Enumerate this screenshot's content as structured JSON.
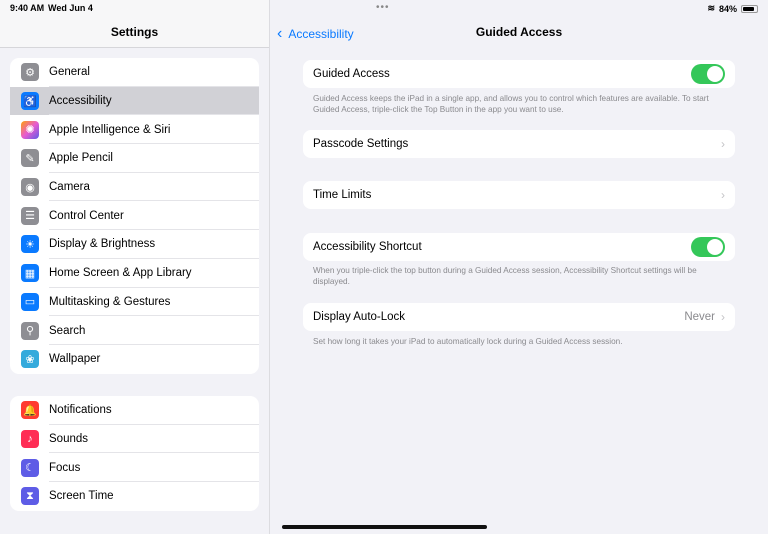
{
  "status": {
    "time": "9:40 AM",
    "date": "Wed Jun 4",
    "battery": "84%"
  },
  "sidebar": {
    "title": "Settings",
    "group1": [
      {
        "label": "General",
        "icon": "gear-icon",
        "color": "#8e8e93",
        "glyph": "⚙"
      },
      {
        "label": "Accessibility",
        "icon": "accessibility-icon",
        "color": "#0a7aff",
        "glyph": "♿"
      },
      {
        "label": "Apple Intelligence & Siri",
        "icon": "siri-icon",
        "color": "#e85bd0",
        "glyph": "✺"
      },
      {
        "label": "Apple Pencil",
        "icon": "pencil-icon",
        "color": "#8e8e93",
        "glyph": "✎"
      },
      {
        "label": "Camera",
        "icon": "camera-icon",
        "color": "#8e8e93",
        "glyph": "◉"
      },
      {
        "label": "Control Center",
        "icon": "toggles-icon",
        "color": "#8e8e93",
        "glyph": "☰"
      },
      {
        "label": "Display & Brightness",
        "icon": "sun-icon",
        "color": "#0a7aff",
        "glyph": "☀"
      },
      {
        "label": "Home Screen & App Library",
        "icon": "home-screen-icon",
        "color": "#0a7aff",
        "glyph": "▦"
      },
      {
        "label": "Multitasking & Gestures",
        "icon": "multitasking-icon",
        "color": "#0a7aff",
        "glyph": "▭"
      },
      {
        "label": "Search",
        "icon": "search-icon",
        "color": "#8e8e93",
        "glyph": "⚲"
      },
      {
        "label": "Wallpaper",
        "icon": "wallpaper-icon",
        "color": "#34aadc",
        "glyph": "❀"
      }
    ],
    "group2": [
      {
        "label": "Notifications",
        "icon": "bell-icon",
        "color": "#ff3b30",
        "glyph": "🔔"
      },
      {
        "label": "Sounds",
        "icon": "speaker-icon",
        "color": "#ff2d55",
        "glyph": "♪"
      },
      {
        "label": "Focus",
        "icon": "moon-icon",
        "color": "#5e5ce6",
        "glyph": "☾"
      },
      {
        "label": "Screen Time",
        "icon": "hourglass-icon",
        "color": "#5e5ce6",
        "glyph": "⧗"
      }
    ]
  },
  "nav": {
    "back": "Accessibility",
    "title": "Guided Access"
  },
  "main": {
    "guided_access": "Guided Access",
    "guided_access_on": true,
    "guided_footer": "Guided Access keeps the iPad in a single app, and allows you to control which features are available. To start Guided Access, triple-click the Top Button in the app you want to use.",
    "passcode": "Passcode Settings",
    "time_limits": "Time Limits",
    "shortcut": "Accessibility Shortcut",
    "shortcut_on": true,
    "shortcut_footer": "When you triple-click the top button during a Guided Access session, Accessibility Shortcut settings will be displayed.",
    "autolock": "Display Auto-Lock",
    "autolock_value": "Never",
    "autolock_footer": "Set how long it takes your iPad to automatically lock during a Guided Access session."
  }
}
